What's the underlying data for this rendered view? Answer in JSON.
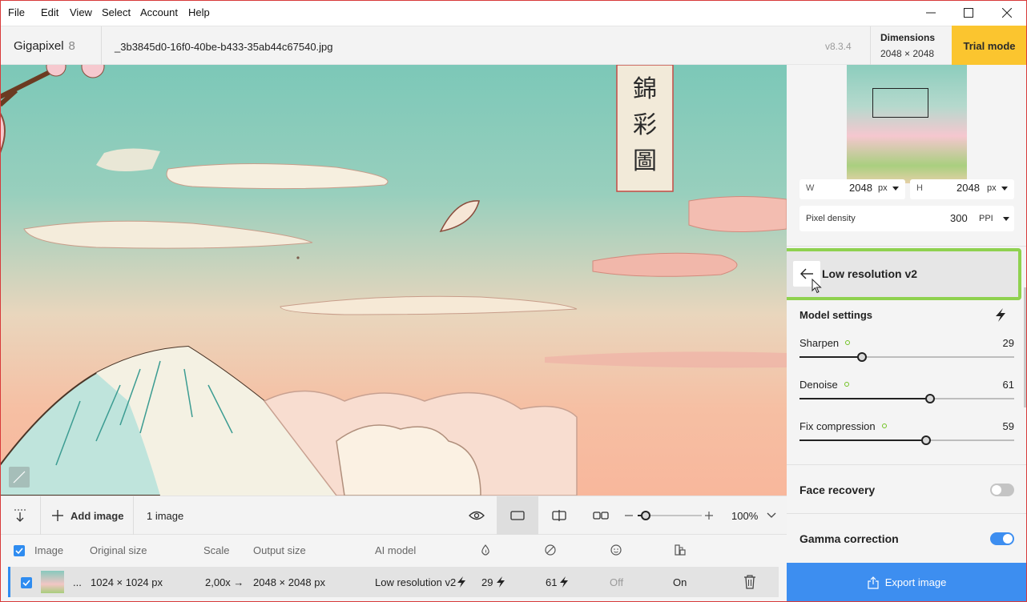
{
  "menu": [
    "File",
    "Edit",
    "View",
    "Select",
    "Account",
    "Help"
  ],
  "window_controls": {
    "minimize": "—",
    "maximize": "☐",
    "close": "✕"
  },
  "header": {
    "app_name": "Gigapixel",
    "app_version_badge": "8",
    "filename": "_3b3845d0-16f0-40be-b433-35ab44c67540.jpg",
    "version": "v8.3.4",
    "dimensions_label": "Dimensions",
    "dimensions_value": "2048 × 2048",
    "trial_label": "Trial mode"
  },
  "canvas": {
    "description_icon": "compare-icon",
    "artwork_text": "錦 彩 圖"
  },
  "toolbar": {
    "add_image_label": "Add image",
    "image_count": "1 image",
    "zoom": "100%",
    "zoom_slider": 0.2
  },
  "table": {
    "headers": {
      "image": "Image",
      "original": "Original size",
      "scale": "Scale",
      "output": "Output size",
      "model": "AI model"
    },
    "row": {
      "name": "...",
      "original": "1024 × 1024 px",
      "scale": "2,00x →",
      "output": "2048 × 2048 px",
      "model": "Low resolution v2",
      "sharpen": "29",
      "denoise": "61",
      "face": "Off",
      "gamma": "On"
    }
  },
  "panel": {
    "w_label": "W",
    "w_value": "2048",
    "w_unit": "px",
    "h_label": "H",
    "h_value": "2048",
    "h_unit": "px",
    "density_label": "Pixel density",
    "density_value": "300",
    "density_unit": "PPI",
    "model_title": "Low resolution v2",
    "model_settings_label": "Model settings",
    "sliders": [
      {
        "label": "Sharpen",
        "value": "29",
        "fraction": 0.29
      },
      {
        "label": "Denoise",
        "value": "61",
        "fraction": 0.61
      },
      {
        "label": "Fix compression",
        "value": "59",
        "fraction": 0.59
      }
    ],
    "face_recovery_label": "Face recovery",
    "face_recovery_on": false,
    "gamma_label": "Gamma correction",
    "gamma_on": true,
    "export_label": "Export image"
  },
  "colors": {
    "accent": "#3d8ef0",
    "trial": "#fbc52f",
    "highlight": "#8fd14f"
  }
}
